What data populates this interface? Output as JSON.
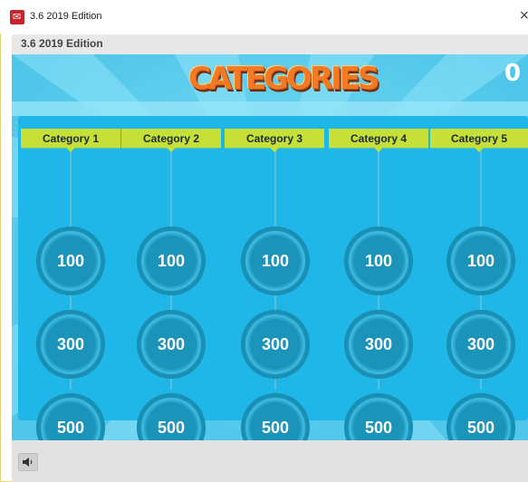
{
  "window": {
    "title": "3.6 2019 Edition",
    "close_glyph": "×"
  },
  "header": {
    "edition": "3.6 2019 Edition"
  },
  "game": {
    "logo_text": "CATEGORIES",
    "score": "0"
  },
  "board": {
    "categories": [
      {
        "label": "Category 1",
        "values": [
          "100",
          "300",
          "500"
        ]
      },
      {
        "label": "Category 2",
        "values": [
          "100",
          "300",
          "500"
        ]
      },
      {
        "label": "Category 3",
        "values": [
          "100",
          "300",
          "500"
        ]
      },
      {
        "label": "Category 4",
        "values": [
          "100",
          "300",
          "500"
        ]
      },
      {
        "label": "Category 5",
        "values": [
          "100",
          "300",
          "500"
        ]
      }
    ]
  },
  "icons": {
    "app": "app-icon",
    "sound": "speaker-icon",
    "close": "close-icon"
  },
  "colors": {
    "stage_bg": "#5ccfee",
    "board_bg": "#1fb6e8",
    "tab_bg": "#c7e038",
    "coin": "#1d97be",
    "logo": "#f37a24"
  }
}
